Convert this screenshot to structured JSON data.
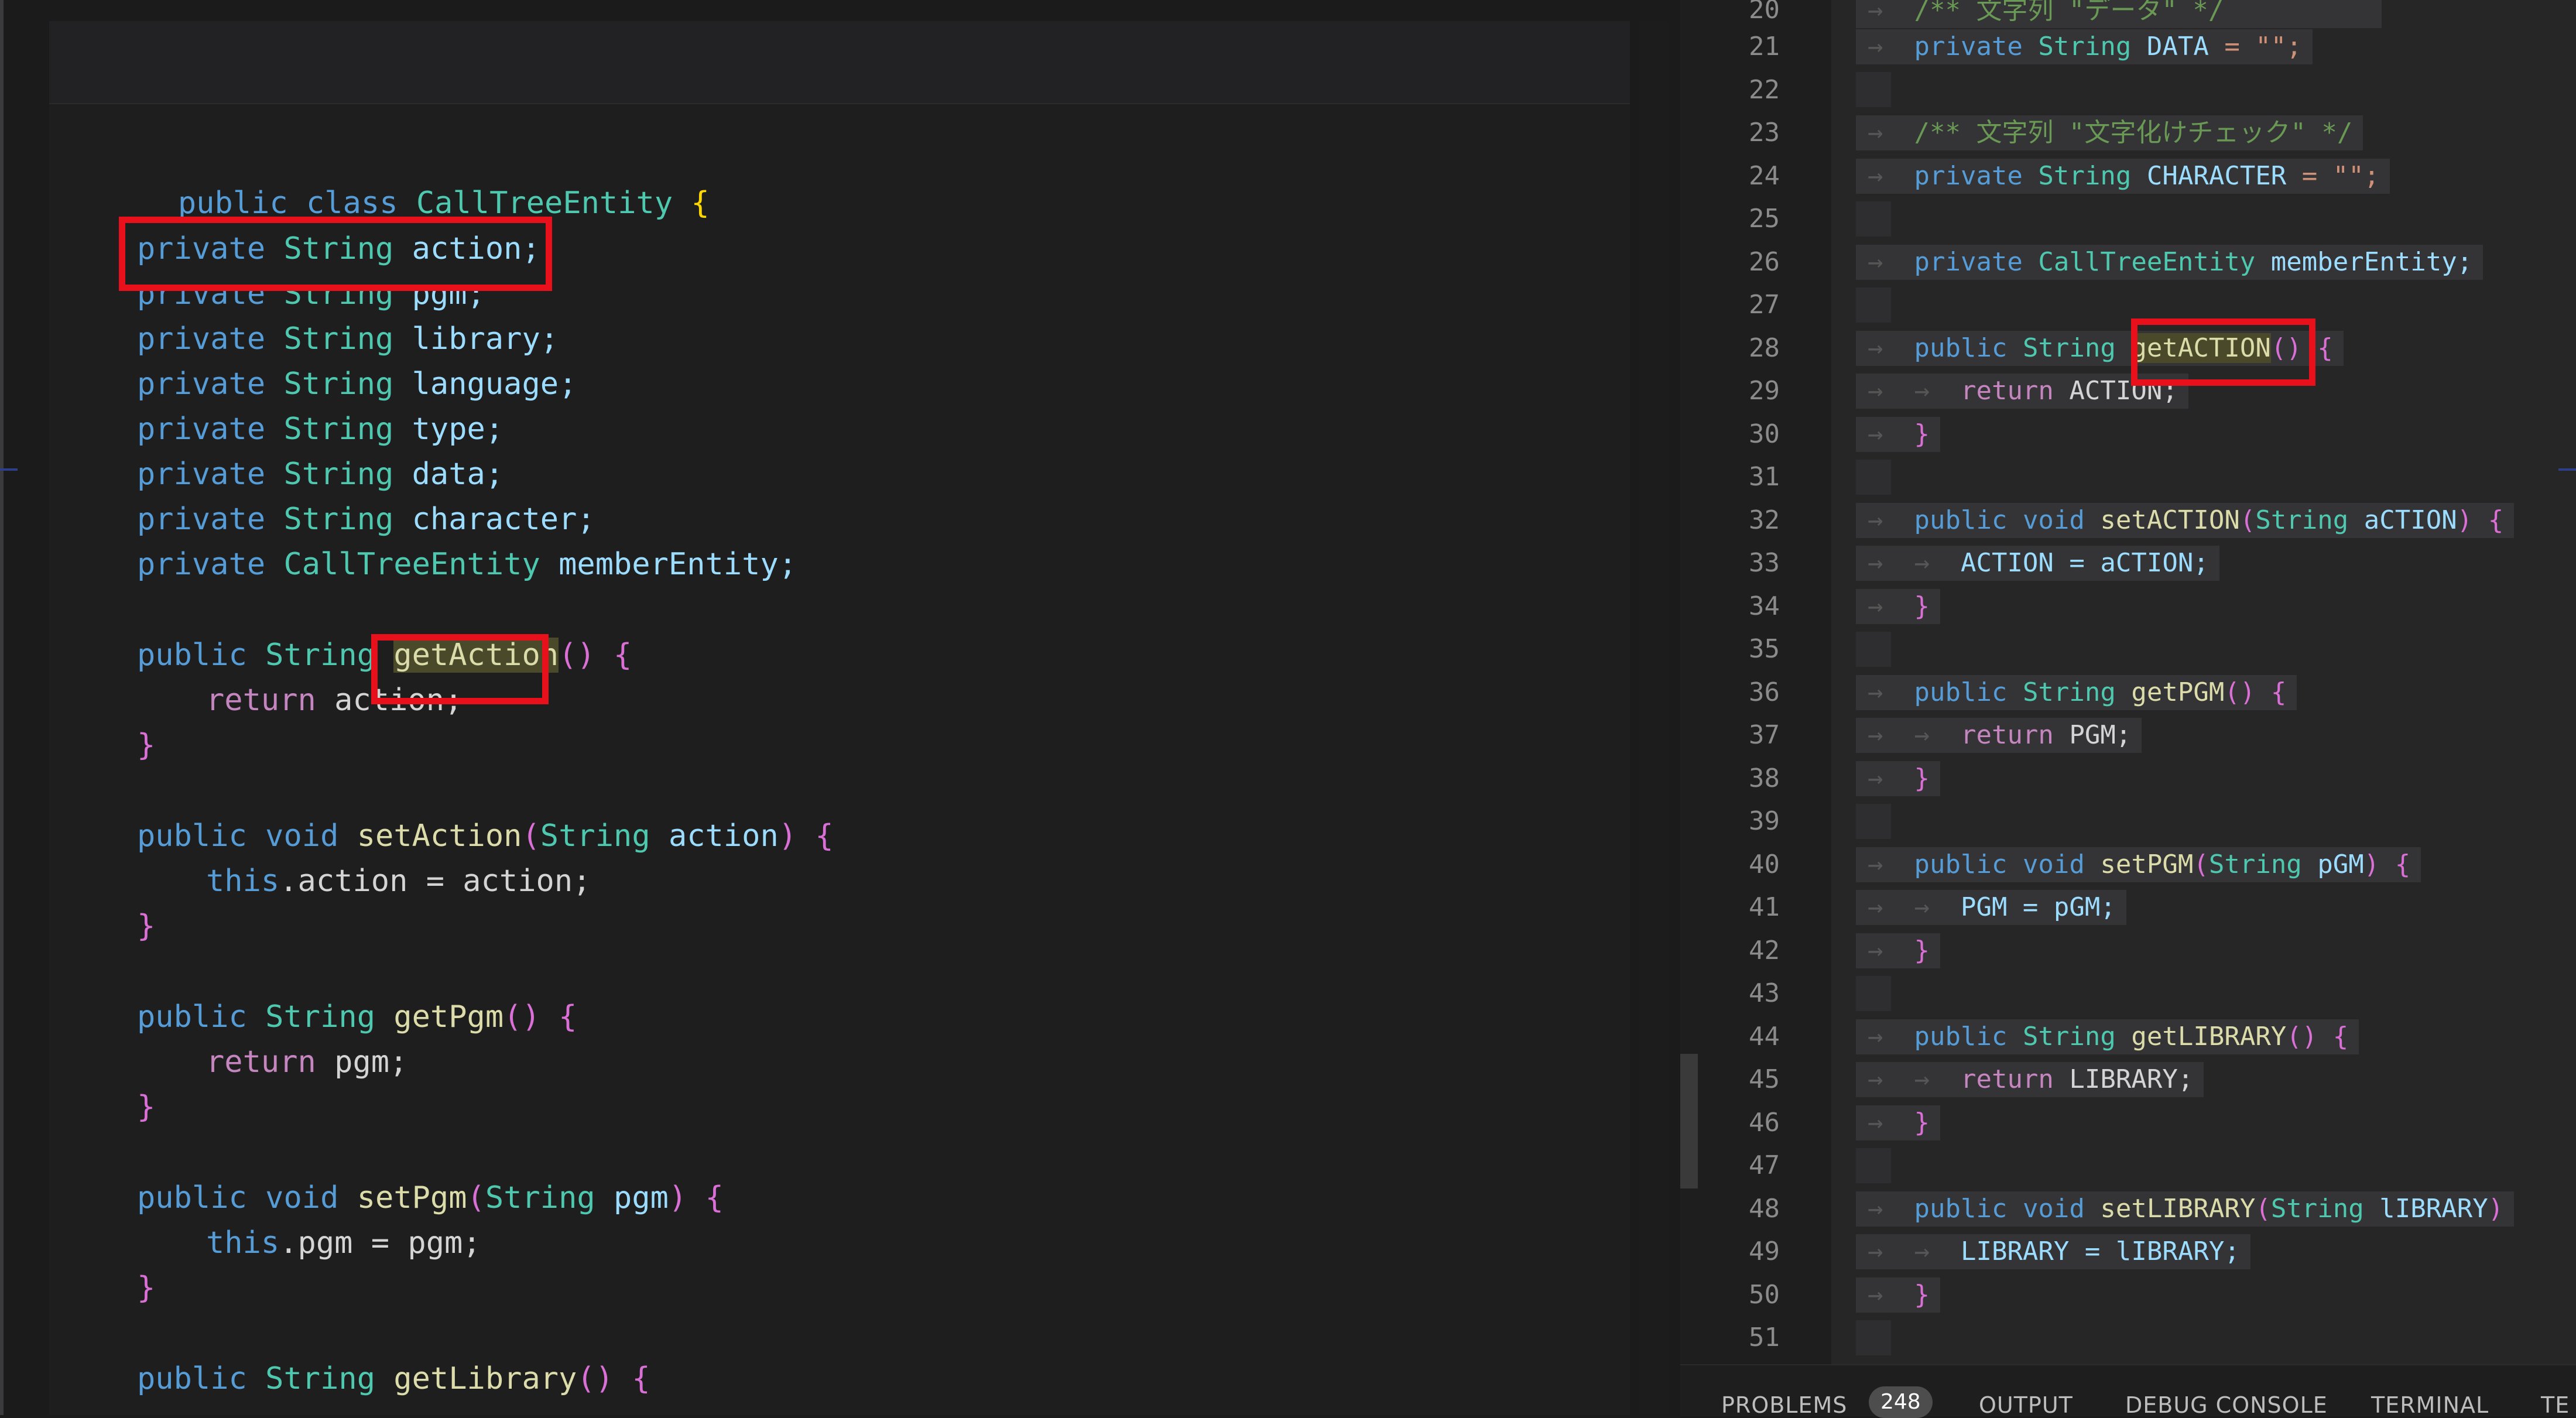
{
  "left_editor": {
    "lines": {
      "class_decl": {
        "kw1": "public",
        "kw2": "class",
        "name": "CallTreeEntity",
        "brace": "{"
      },
      "f_action": {
        "kw": "private",
        "ty": "String",
        "name": "action;"
      },
      "f_pgm": {
        "kw": "private",
        "ty": "String",
        "name": "pgm;"
      },
      "f_library": {
        "kw": "private",
        "ty": "String",
        "name": "library;"
      },
      "f_language": {
        "kw": "private",
        "ty": "String",
        "name": "language;"
      },
      "f_type": {
        "kw": "private",
        "ty": "String",
        "name": "type;"
      },
      "f_data": {
        "kw": "private",
        "ty": "String",
        "name": "data;"
      },
      "f_character": {
        "kw": "private",
        "ty": "String",
        "name": "character;"
      },
      "f_member": {
        "kw": "private",
        "ty": "CallTreeEntity",
        "name": "memberEntity;"
      },
      "m_getaction": {
        "kw": "public",
        "ty": "String",
        "fn": "getAction",
        "paren": "()",
        "brace": "{"
      },
      "r_action": {
        "kw": "return",
        "val": "action;"
      },
      "close1": "}",
      "m_setaction": {
        "kw": "public",
        "ty": "void",
        "fn": "setAction",
        "open": "(",
        "pty": "String",
        "param": "action",
        "close": ")",
        "brace": "{"
      },
      "s_action": {
        "kw": "this",
        "rest": ".action = action;"
      },
      "close2": "}",
      "m_getpgm": {
        "kw": "public",
        "ty": "String",
        "fn": "getPgm",
        "paren": "()",
        "brace": "{"
      },
      "r_pgm": {
        "kw": "return",
        "val": "pgm;"
      },
      "close3": "}",
      "m_setpgm": {
        "kw": "public",
        "ty": "void",
        "fn": "setPgm",
        "open": "(",
        "pty": "String",
        "param": "pgm",
        "close": ")",
        "brace": "{"
      },
      "s_pgm": {
        "kw": "this",
        "rest": ".pgm = pgm;"
      },
      "close4": "}",
      "m_getlibrary": {
        "kw": "public",
        "ty": "String",
        "fn": "getLibrary",
        "paren": "()",
        "brace": "{"
      }
    }
  },
  "right_editor": {
    "line_numbers": [
      "20",
      "21",
      "22",
      "23",
      "24",
      "25",
      "26",
      "27",
      "28",
      "29",
      "30",
      "31",
      "32",
      "33",
      "34",
      "35",
      "36",
      "37",
      "38",
      "39",
      "40",
      "41",
      "42",
      "43",
      "44",
      "45",
      "46",
      "47",
      "48",
      "49",
      "50",
      "51"
    ],
    "lines": {
      "l20": "/** 文字列 \"データ\" */",
      "l21": {
        "kw": "private",
        "ty": "String",
        "name": "DATA",
        "rest": " = \"\";"
      },
      "l23": "/** 文字列 \"文字化けチェック\" */",
      "l24": {
        "kw": "private",
        "ty": "String",
        "name": "CHARACTER",
        "rest": " = \"\";"
      },
      "l26": {
        "kw": "private",
        "ty": "CallTreeEntity",
        "name": "memberEntity;"
      },
      "l28": {
        "kw": "public",
        "ty": "String",
        "fn": "getACTION",
        "paren": "()",
        "brace": "{"
      },
      "l29": {
        "kw": "return",
        "val": "ACTION;"
      },
      "l30": "}",
      "l32": {
        "kw": "public",
        "ty": "void",
        "fn": "setACTION",
        "open": "(",
        "pty": "String",
        "param": "aCTION",
        "close": ")",
        "brace": "{"
      },
      "l33": {
        "val": "ACTION = aCTION;"
      },
      "l34": "}",
      "l36": {
        "kw": "public",
        "ty": "String",
        "fn": "getPGM",
        "paren": "()",
        "brace": "{"
      },
      "l37": {
        "kw": "return",
        "val": "PGM;"
      },
      "l38": "}",
      "l40": {
        "kw": "public",
        "ty": "void",
        "fn": "setPGM",
        "open": "(",
        "pty": "String",
        "param": "pGM",
        "close": ")",
        "brace": "{"
      },
      "l41": {
        "val": "PGM = pGM;"
      },
      "l42": "}",
      "l44": {
        "kw": "public",
        "ty": "String",
        "fn": "getLIBRARY",
        "paren": "()",
        "brace": "{"
      },
      "l45": {
        "kw": "return",
        "val": "LIBRARY;"
      },
      "l46": "}",
      "l48": {
        "kw": "public",
        "ty": "void",
        "fn": "setLIBRARY",
        "open": "(",
        "pty": "String",
        "param": "lIBRARY",
        "close": ")"
      },
      "l49": {
        "val": "LIBRARY = lIBRARY;"
      },
      "l50": "}"
    }
  },
  "panel": {
    "tabs": [
      "PROBLEMS",
      "OUTPUT",
      "DEBUG CONSOLE",
      "TERMINAL",
      "TE"
    ],
    "problems_count": "248"
  },
  "colors": {
    "highlight_box": "#e8101a",
    "editor_bg": "#1e1e1f",
    "keyword": "#569cd6",
    "type": "#4ec9b0",
    "function": "#dcdcaa"
  }
}
